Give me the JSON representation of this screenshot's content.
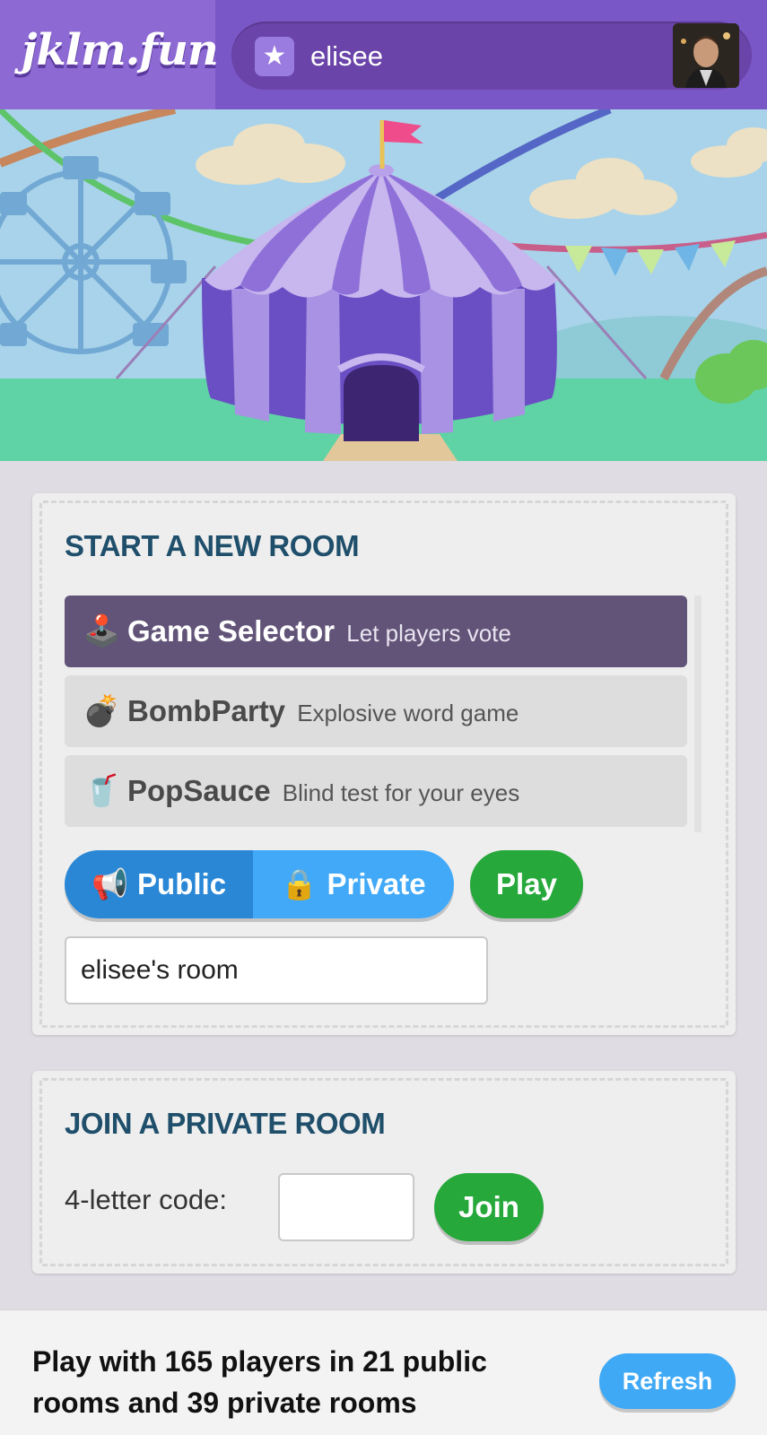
{
  "header": {
    "logo": "jklm.fun",
    "username": "elisee",
    "star_icon": "star-icon",
    "colors": {
      "header_bg": "#7a57c7",
      "logo_bg": "#8d69d3",
      "pill_bg": "#6a44a9"
    }
  },
  "new_room": {
    "title": "START A NEW ROOM",
    "games": [
      {
        "emoji": "🕹️",
        "name": "Game Selector",
        "description": "Let players vote",
        "selected": true
      },
      {
        "emoji": "💣",
        "name": "BombParty",
        "description": "Explosive word game",
        "selected": false
      },
      {
        "emoji": "🥤",
        "name": "PopSauce",
        "description": "Blind test for your eyes",
        "selected": false
      }
    ],
    "visibility": {
      "public_emoji": "📢",
      "public_label": "Public",
      "private_emoji": "🔒",
      "private_label": "Private",
      "selected": "public"
    },
    "play_label": "Play",
    "room_name_value": "elisee's room"
  },
  "join_room": {
    "title": "JOIN A PRIVATE ROOM",
    "code_label": "4-letter code:",
    "code_value": "",
    "join_label": "Join"
  },
  "footer": {
    "status_text": "Play with 165 players in 21 public rooms and 39 private rooms",
    "refresh_label": "Refresh"
  },
  "colors": {
    "accent_green": "#26a83b",
    "accent_blue": "#41a9f7",
    "title_color": "#1f4f6b",
    "selected_game_bg": "#625478"
  }
}
